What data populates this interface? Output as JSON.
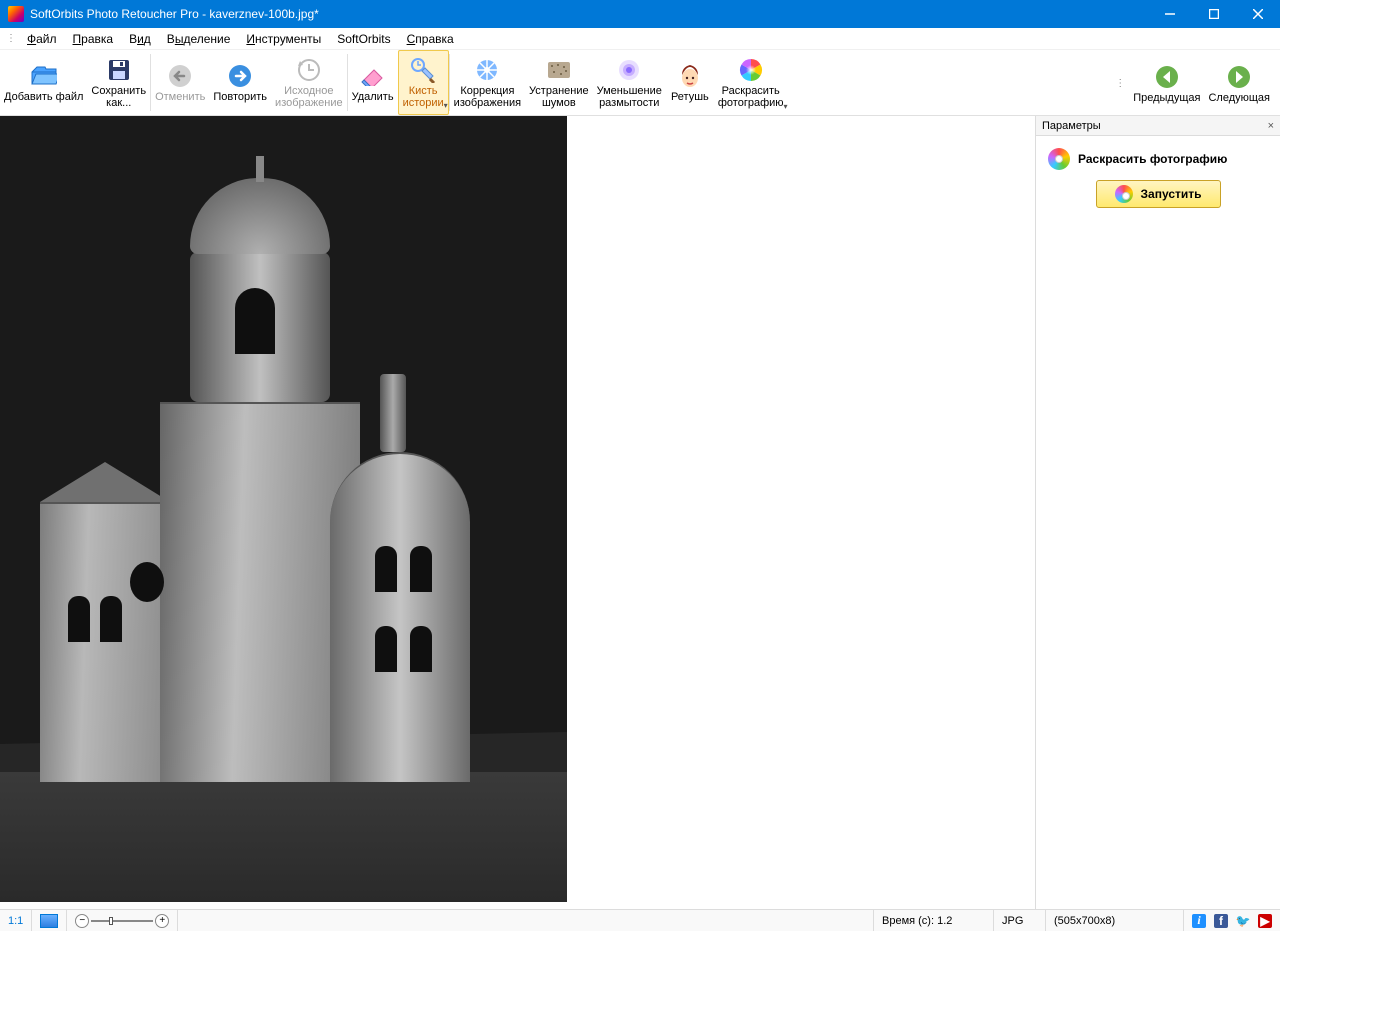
{
  "titlebar": {
    "title": "SoftOrbits Photo Retoucher Pro - kaverznev-100b.jpg*"
  },
  "menu": {
    "file": "Файл",
    "edit": "Правка",
    "view": "Вид",
    "selection": "Выделение",
    "tools": "Инструменты",
    "softorbits": "SoftOrbits",
    "help": "Справка"
  },
  "toolbar": {
    "add_file": "Добавить файл",
    "save_as": "Сохранить как...",
    "undo": "Отменить",
    "redo": "Повторить",
    "original": "Исходное изображение",
    "remove": "Удалить",
    "history_brush": "Кисть истории",
    "color_correct": "Коррекция изображения",
    "denoise": "Устранение шумов",
    "deblur": "Уменьшение размытости",
    "retouch": "Ретушь",
    "colorize": "Раскрасить фотографию",
    "prev": "Предыдущая",
    "next": "Следующая"
  },
  "side": {
    "header": "Параметры",
    "section": "Раскрасить фотографию",
    "run": "Запустить"
  },
  "status": {
    "zoom11": "1:1",
    "time": "Время (с): 1.2",
    "format": "JPG",
    "dims": "(505x700x8)"
  }
}
